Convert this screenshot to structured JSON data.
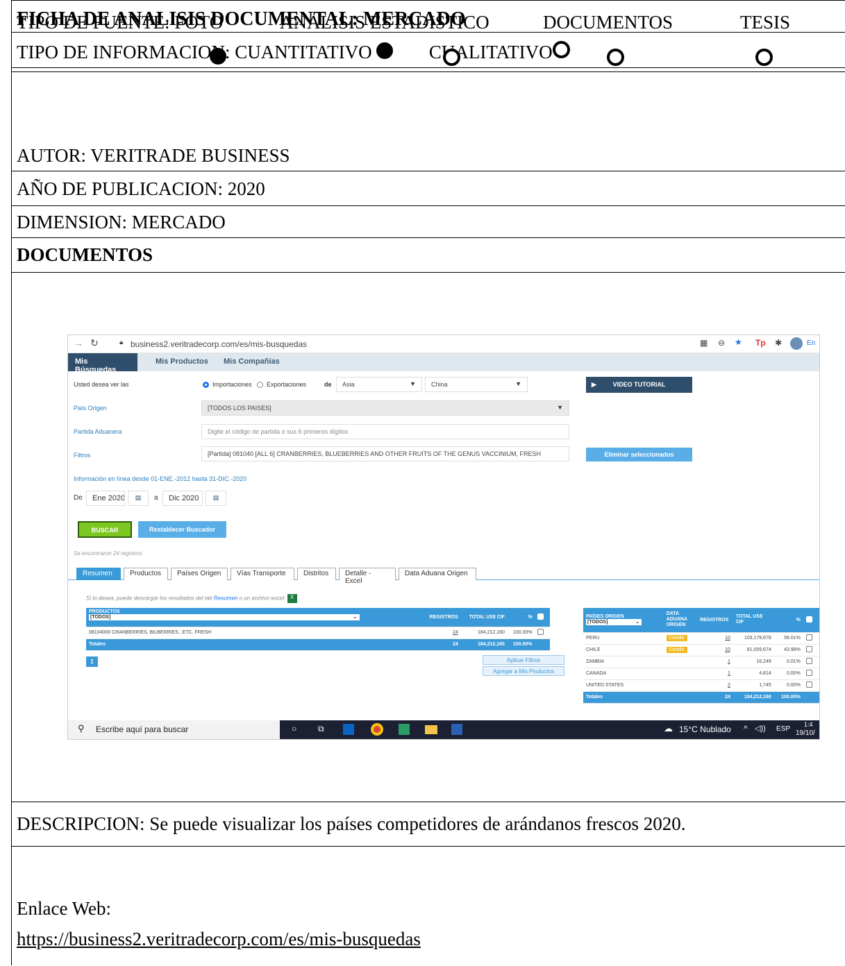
{
  "header": {
    "title": "FICHA DE ANALISIS DOCUMENTAL: MERCADO",
    "tipo_info_label": "TIPO DE INFORMACION: CUANTITATIVO",
    "cualitativo": "CUALITATIVO",
    "tipo_fuente_label": "TIPO DE FUENTE: FOTO",
    "fuente_analisis": "ANALISIS ESTADISTICO",
    "fuente_documentos": "DOCUMENTOS",
    "fuente_tesis": "TESIS",
    "autor": "AUTOR: VERITRADE BUSINESS",
    "anio": "AÑO DE PUBLICACION: 2020",
    "dimension": "DIMENSION: MERCADO",
    "documentos": "DOCUMENTOS",
    "descripcion": "DESCRIPCION: Se puede visualizar los países competidores de arándanos frescos 2020.",
    "enlace_label": "Enlace Web:",
    "enlace_url": "https://business2.veritradecorp.com/es/mis-busquedas"
  },
  "screenshot": {
    "url": "business2.veritradecorp.com/es/mis-busquedas",
    "nav": [
      "Mis Búsquedas",
      "Mis Productos",
      "Mis Compañías"
    ],
    "usted_desea": "Usted desea ver las",
    "importaciones": "Importaciones",
    "exportaciones": "Exportaciones",
    "de": "de",
    "region": "Asia",
    "pais": "China",
    "video_tutorial": "VIDEO TUTORIAL",
    "pais_origen_label": "País Origen",
    "pais_origen_value": "[TODOS LOS PAISES]",
    "partida_label": "Partida Aduanera",
    "partida_placeholder": "Digite el código de partida o sus 6 primeros dígitos",
    "filtros_label": "Filtros",
    "filtros_value": "[Partida] 081040 [ALL 6] CRANBERRIES, BLUEBERRIES AND OTHER FRUITS OF THE GENUS VACCINIUM, FRESH",
    "eliminar": "Eliminar seleccionados",
    "info_linea": "Información en línea desde 01-ENE.-2012 hasta 31-DIC.-2020",
    "de_label": "De",
    "fecha_desde": "Ene 2020",
    "a_label": "a",
    "fecha_hasta": "Dic 2020",
    "buscar": "BUSCAR",
    "restablecer": "Restablecer Buscador",
    "encontraron": "Se encontraron 24 registros",
    "tabs": [
      "Resumen",
      "Productos",
      "Países Origen",
      "Vías Transporte",
      "Distritos",
      "Detalle - Excel",
      "Data Aduana Origen"
    ],
    "descarga_note": "Si lo desea, puede descargar los resultados del tab",
    "descarga_link": "Resumen",
    "descarga_end": "o un archivo excel:",
    "prod_table": {
      "headers": [
        "PRODUCTOS",
        "REGISTROS",
        "TOTAL US$ CIF",
        "%"
      ],
      "filter": "[TODOS]",
      "row": [
        "08104000 CRANBERRIES, BILBERRIES...ETC. FRESH",
        "24",
        "184,212,160",
        "100.00%"
      ],
      "totals": [
        "Totales",
        "24",
        "184,212,160",
        "100.00%"
      ]
    },
    "page_num": "1",
    "aplicar": "Aplicar Filtros",
    "agregar": "Agregar a Mis Productos",
    "country_table": {
      "headers": [
        "PAÍSES ORIGEN",
        "DATA ADUANA ORIGEN",
        "REGISTROS",
        "TOTAL US$ CIF",
        "%"
      ],
      "filter": "[TODOS]",
      "detalle": "Detalle",
      "rows": [
        [
          "PERU",
          "10",
          "103,179,678",
          "56.01%"
        ],
        [
          "CHILE",
          "10",
          "81,009,674",
          "43.98%"
        ],
        [
          "ZAMBIA",
          "1",
          "16,249",
          "0.01%"
        ],
        [
          "CANADA",
          "1",
          "4,814",
          "0.00%"
        ],
        [
          "UNITED STATES",
          "2",
          "1,745",
          "0.00%"
        ]
      ],
      "totals": [
        "Totales",
        "24",
        "184,212,160",
        "100.00%"
      ]
    },
    "taskbar": {
      "search": "Escribe aquí para buscar",
      "weather": "15°C Nublado",
      "lang": "ESP",
      "time": "1:4",
      "date": "19/10/"
    },
    "profile_text": "En"
  }
}
